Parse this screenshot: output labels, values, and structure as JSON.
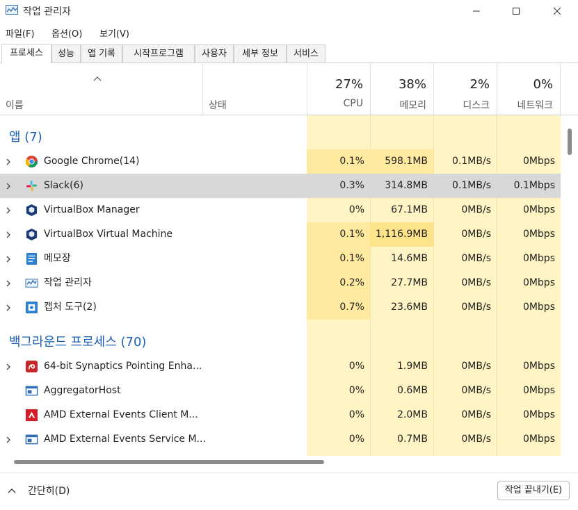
{
  "window": {
    "title": "작업 관리자",
    "minimize_icon": "minimize-icon",
    "maximize_icon": "maximize-icon",
    "close_icon": "close-icon"
  },
  "menu": [
    "파일(F)",
    "옵션(O)",
    "보기(V)"
  ],
  "tabs": [
    "프로세스",
    "성능",
    "앱 기록",
    "시작프로그램",
    "사용자",
    "세부 정보",
    "서비스"
  ],
  "active_tab": "프로세스",
  "header": {
    "name_label": "이름",
    "status_label": "상태",
    "sort_icon": "sort-up-icon",
    "cpu": {
      "pct": "27%",
      "label": "CPU"
    },
    "memory": {
      "pct": "38%",
      "label": "메모리"
    },
    "disk": {
      "pct": "2%",
      "label": "디스크"
    },
    "network": {
      "pct": "0%",
      "label": "네트워크"
    }
  },
  "groups": [
    {
      "title": "앱 (7)"
    },
    {
      "title": "백그라운드 프로세스 (70)"
    }
  ],
  "apps": [
    {
      "name": "Google Chrome(14)",
      "cpu": "0.1%",
      "memory": "598.1MB",
      "disk": "0.1MB/s",
      "network": "0Mbps",
      "icon": "chrome-icon",
      "expandable": true
    },
    {
      "name": "Slack(6)",
      "cpu": "0.3%",
      "memory": "314.8MB",
      "disk": "0.1MB/s",
      "network": "0.1Mbps",
      "icon": "slack-icon",
      "expandable": true,
      "selected": true
    },
    {
      "name": "VirtualBox Manager",
      "cpu": "0%",
      "memory": "67.1MB",
      "disk": "0MB/s",
      "network": "0Mbps",
      "icon": "virtualbox-icon",
      "expandable": true
    },
    {
      "name": "VirtualBox Virtual Machine",
      "cpu": "0.1%",
      "memory": "1,116.9MB",
      "disk": "0MB/s",
      "network": "0Mbps",
      "icon": "virtualbox-icon",
      "expandable": true
    },
    {
      "name": "메모장",
      "cpu": "0.1%",
      "memory": "14.6MB",
      "disk": "0MB/s",
      "network": "0Mbps",
      "icon": "notepad-icon",
      "expandable": true
    },
    {
      "name": "작업 관리자",
      "cpu": "0.2%",
      "memory": "27.7MB",
      "disk": "0MB/s",
      "network": "0Mbps",
      "icon": "task-manager-icon",
      "expandable": true
    },
    {
      "name": "캡처 도구(2)",
      "cpu": "0.7%",
      "memory": "23.6MB",
      "disk": "0MB/s",
      "network": "0Mbps",
      "icon": "snipping-tool-icon",
      "expandable": true
    }
  ],
  "background": [
    {
      "name": "64-bit Synaptics Pointing Enha...",
      "cpu": "0%",
      "memory": "1.9MB",
      "disk": "0MB/s",
      "network": "0Mbps",
      "icon": "synaptics-icon",
      "expandable": true
    },
    {
      "name": "AggregatorHost",
      "cpu": "0%",
      "memory": "0.6MB",
      "disk": "0MB/s",
      "network": "0Mbps",
      "icon": "window-app-icon",
      "expandable": false
    },
    {
      "name": "AMD External Events Client M...",
      "cpu": "0%",
      "memory": "2.0MB",
      "disk": "0MB/s",
      "network": "0Mbps",
      "icon": "amd-icon",
      "expandable": false
    },
    {
      "name": "AMD External Events Service M...",
      "cpu": "0%",
      "memory": "0.7MB",
      "disk": "0MB/s",
      "network": "0Mbps",
      "icon": "window-app-icon",
      "expandable": true
    }
  ],
  "footer": {
    "collapse_label": "간단히(D)",
    "collapse_icon": "chevron-up-icon",
    "end_task_label": "작업 끝내기(E)"
  },
  "colors": {
    "accent": "#1a5fb4",
    "heat_light": "#fff4c4",
    "heat_mid": "#ffeaa0",
    "heat_strong": "#fde48a",
    "selected_row": "#d8d8d8"
  }
}
